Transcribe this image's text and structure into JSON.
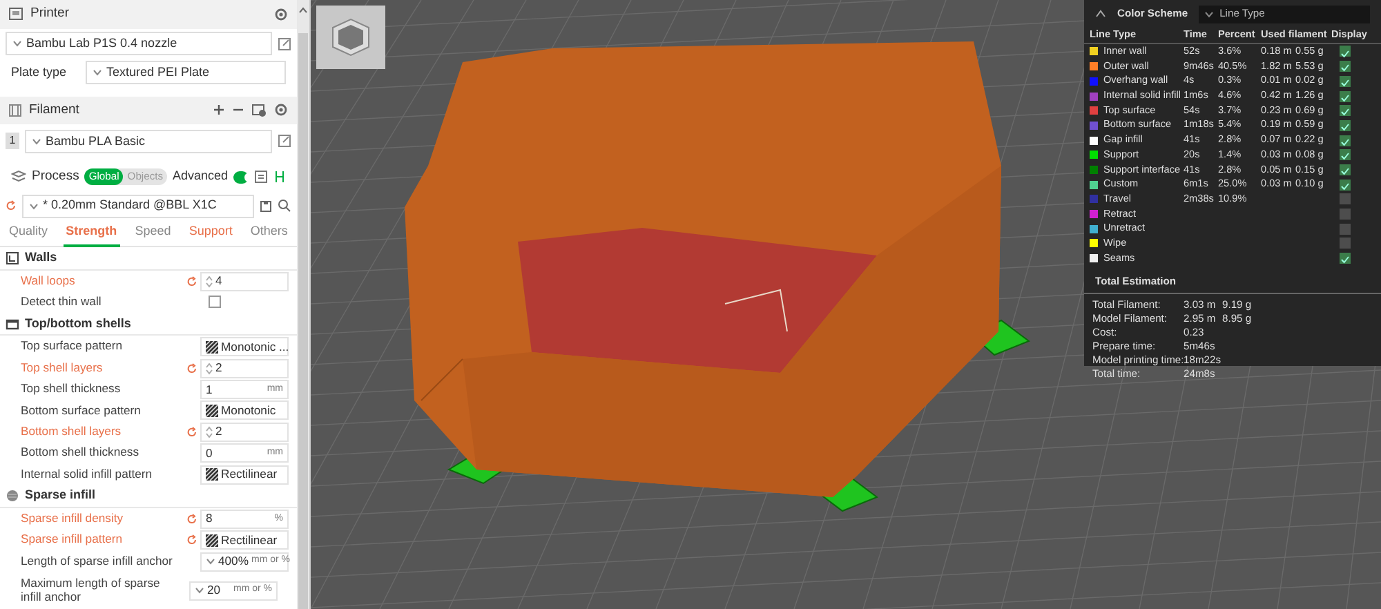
{
  "printer": {
    "title": "Printer",
    "preset": "Bambu Lab P1S 0.4 nozzle",
    "plate_type_label": "Plate type",
    "plate_type": "Textured PEI Plate"
  },
  "filament": {
    "title": "Filament",
    "items": [
      {
        "index": "1",
        "name": "Bambu PLA Basic"
      }
    ]
  },
  "process": {
    "title": "Process",
    "scope_tabs": [
      {
        "label": "Global",
        "selected": true
      },
      {
        "label": "Objects",
        "selected": false
      }
    ],
    "advanced_label": "Advanced",
    "advanced_on": true,
    "preset": "* 0.20mm Standard @BBL X1C"
  },
  "tabs": [
    {
      "label": "Quality",
      "selected": false,
      "modified": false
    },
    {
      "label": "Strength",
      "selected": true,
      "modified": true
    },
    {
      "label": "Speed",
      "selected": false,
      "modified": false
    },
    {
      "label": "Support",
      "selected": false,
      "modified": true
    },
    {
      "label": "Others",
      "selected": false,
      "modified": false
    }
  ],
  "sections": [
    {
      "title": "Walls",
      "rows": [
        {
          "label": "Wall loops",
          "kind": "spin",
          "modified": true,
          "value": "4"
        },
        {
          "label": "Detect thin wall",
          "kind": "checkbox",
          "modified": false,
          "checked": false
        }
      ]
    },
    {
      "title": "Top/bottom shells",
      "rows": [
        {
          "label": "Top surface pattern",
          "kind": "pattern",
          "modified": false,
          "value": "Monotonic ..."
        },
        {
          "label": "Top shell layers",
          "kind": "spin",
          "modified": true,
          "value": "2"
        },
        {
          "label": "Top shell thickness",
          "kind": "number",
          "modified": false,
          "value": "1",
          "unit": "mm"
        },
        {
          "label": "Bottom surface pattern",
          "kind": "pattern",
          "modified": false,
          "value": "Monotonic"
        },
        {
          "label": "Bottom shell layers",
          "kind": "spin",
          "modified": true,
          "value": "2"
        },
        {
          "label": "Bottom shell thickness",
          "kind": "number",
          "modified": false,
          "value": "0",
          "unit": "mm"
        },
        {
          "label": "Internal solid infill pattern",
          "kind": "pattern",
          "modified": false,
          "value": "Rectilinear"
        }
      ]
    },
    {
      "title": "Sparse infill",
      "rows": [
        {
          "label": "Sparse infill density",
          "kind": "number",
          "modified": true,
          "value": "8",
          "unit": "%"
        },
        {
          "label": "Sparse infill pattern",
          "kind": "pattern",
          "modified": true,
          "value": "Rectilinear"
        },
        {
          "label": "Length of sparse infill anchor",
          "kind": "combo",
          "modified": false,
          "value": "400%",
          "unit": "mm or %"
        },
        {
          "label": "Maximum length of sparse infill anchor",
          "kind": "combo",
          "modified": false,
          "value": "20",
          "unit": "mm or %"
        }
      ]
    }
  ],
  "legend": {
    "title": "Color Scheme",
    "scheme": "Line Type",
    "columns": [
      "Line Type",
      "Time",
      "Percent",
      "Used filament",
      "Display"
    ],
    "items": [
      {
        "name": "Inner wall",
        "color": "#f0d020",
        "time": "52s",
        "percent": "3.6%",
        "length": "0.18 m",
        "weight": "0.55 g",
        "display": true
      },
      {
        "name": "Outer wall",
        "color": "#ff7f27",
        "time": "9m46s",
        "percent": "40.5%",
        "length": "1.82 m",
        "weight": "5.53 g",
        "display": true
      },
      {
        "name": "Overhang wall",
        "color": "#1010ff",
        "time": "4s",
        "percent": "0.3%",
        "length": "0.01 m",
        "weight": "0.02 g",
        "display": true
      },
      {
        "name": "Internal solid infill",
        "color": "#a040c0",
        "time": "1m6s",
        "percent": "4.6%",
        "length": "0.42 m",
        "weight": "1.26 g",
        "display": true
      },
      {
        "name": "Top surface",
        "color": "#e04040",
        "time": "54s",
        "percent": "3.7%",
        "length": "0.23 m",
        "weight": "0.69 g",
        "display": true
      },
      {
        "name": "Bottom surface",
        "color": "#7050d0",
        "time": "1m18s",
        "percent": "5.4%",
        "length": "0.19 m",
        "weight": "0.59 g",
        "display": true
      },
      {
        "name": "Gap infill",
        "color": "#ffffff",
        "time": "41s",
        "percent": "2.8%",
        "length": "0.07 m",
        "weight": "0.22 g",
        "display": true
      },
      {
        "name": "Support",
        "color": "#00e000",
        "time": "20s",
        "percent": "1.4%",
        "length": "0.03 m",
        "weight": "0.08 g",
        "display": true
      },
      {
        "name": "Support interface",
        "color": "#008000",
        "time": "41s",
        "percent": "2.8%",
        "length": "0.05 m",
        "weight": "0.15 g",
        "display": true
      },
      {
        "name": "Custom",
        "color": "#50d090",
        "time": "6m1s",
        "percent": "25.0%",
        "length": "0.03 m",
        "weight": "0.10 g",
        "display": true
      },
      {
        "name": "Travel",
        "color": "#3030a0",
        "time": "2m38s",
        "percent": "10.9%",
        "display": false
      },
      {
        "name": "Retract",
        "color": "#d020d0",
        "display": false
      },
      {
        "name": "Unretract",
        "color": "#40b0d0",
        "display": false
      },
      {
        "name": "Wipe",
        "color": "#ffff00",
        "display": false
      },
      {
        "name": "Seams",
        "color": "#f0f0f0",
        "display": true
      }
    ],
    "total_title": "Total Estimation",
    "totals": [
      {
        "label": "Total Filament:",
        "value": "3.03 m",
        "value_2": "9.19 g"
      },
      {
        "label": "Model Filament:",
        "value": "2.95 m",
        "value_2": "8.95 g"
      },
      {
        "label": "Cost:",
        "value": "0.23"
      },
      {
        "label": "Prepare time:",
        "value": "5m46s"
      },
      {
        "label": "Model printing time:",
        "value": "18m22s"
      },
      {
        "label": "Total time:",
        "value": "24m8s"
      }
    ]
  }
}
